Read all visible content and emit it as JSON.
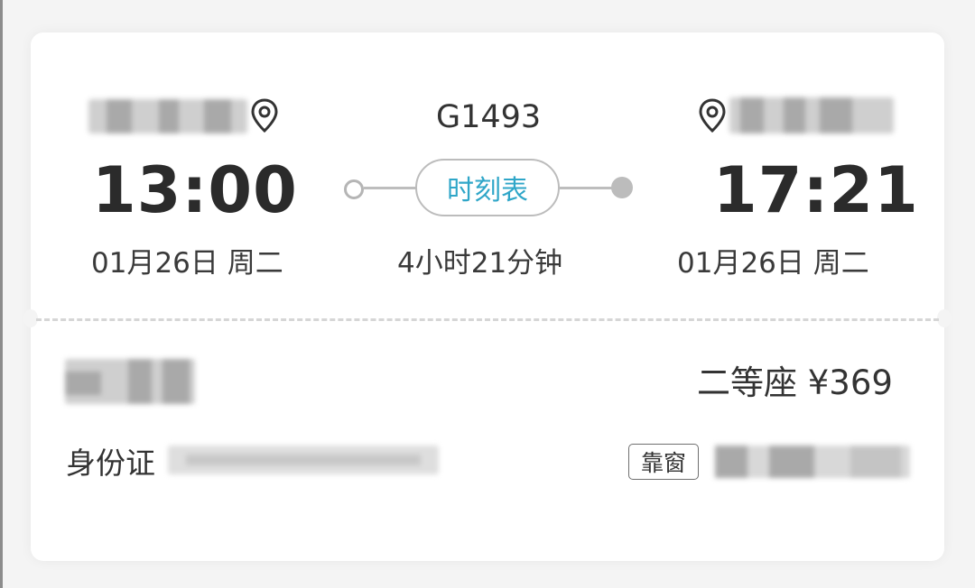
{
  "ticket": {
    "train_number": "G1493",
    "departure": {
      "time": "13:00",
      "date": "01月26日 周二",
      "station_icon": "location-pin-icon"
    },
    "arrival": {
      "time": "17:21",
      "date": "01月26日 周二",
      "station_icon": "location-pin-icon"
    },
    "duration": "4小时21分钟",
    "schedule_button": "时刻表",
    "seat_class_price": "二等座 ¥369",
    "id_label": "身份证",
    "seat_tag": "靠窗"
  },
  "colors": {
    "accent": "#2fa6c8",
    "text": "#333333",
    "line": "#bdbdbd"
  }
}
